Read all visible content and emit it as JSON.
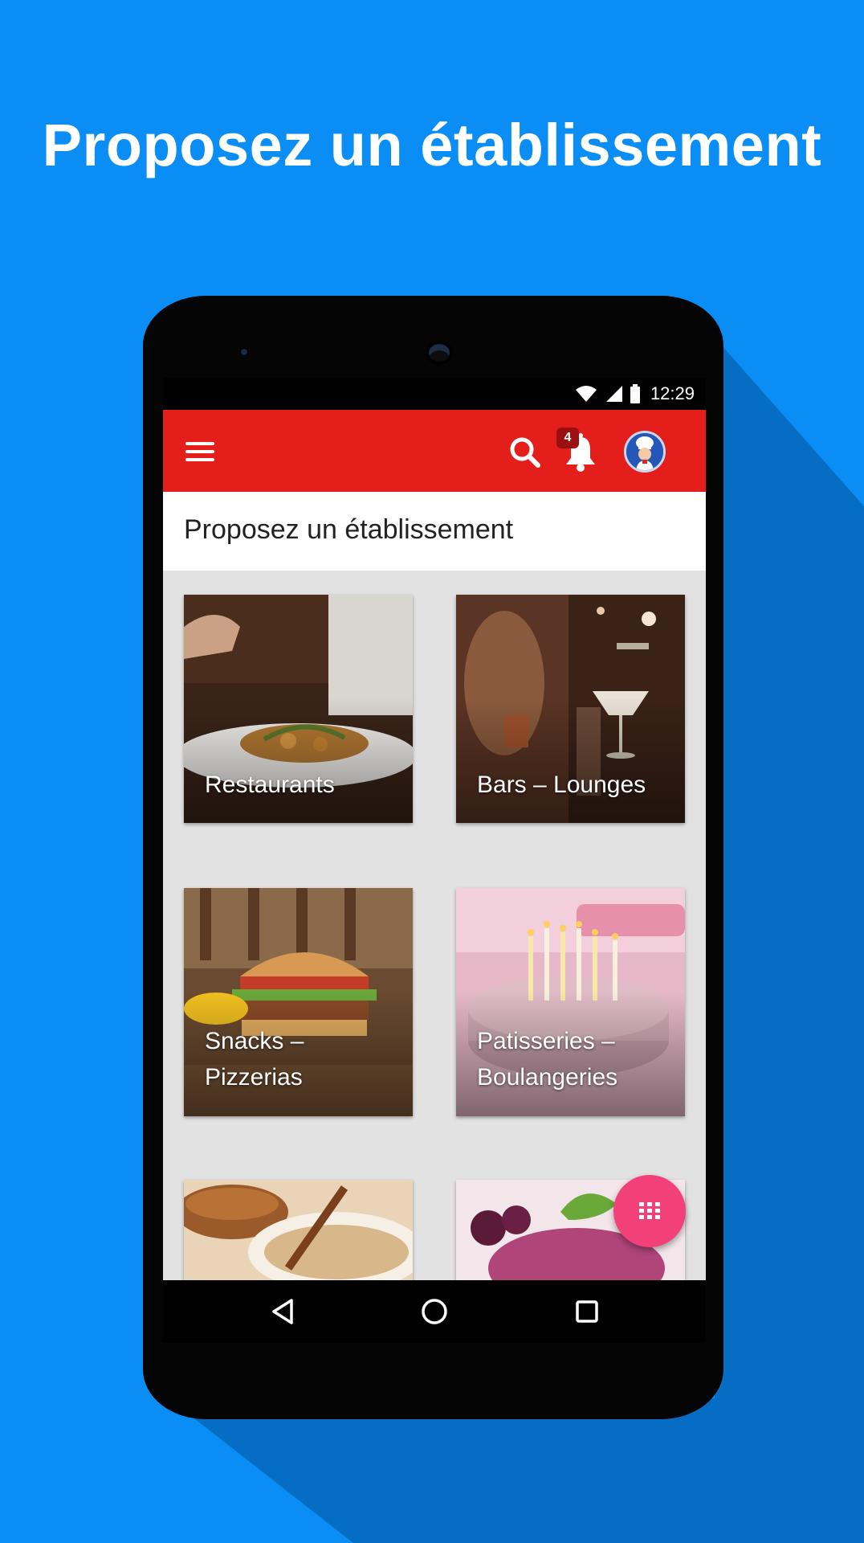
{
  "promo": {
    "title": "Proposez un établissement"
  },
  "status_bar": {
    "time": "12:29",
    "icons": [
      "wifi-icon",
      "signal-icon",
      "battery-icon"
    ]
  },
  "app_bar": {
    "color": "#e31e1b",
    "menu_icon": "menu-icon",
    "search_icon": "search-icon",
    "notifications": {
      "icon": "bell-icon",
      "count": "4"
    },
    "avatar_icon": "chef-avatar"
  },
  "page": {
    "title": "Proposez un établissement"
  },
  "categories": [
    {
      "label": "Restaurants"
    },
    {
      "label": "Bars – Lounges"
    },
    {
      "label": "Snacks – Pizzerias"
    },
    {
      "label": "Patisseries – Boulangeries"
    },
    {
      "label": ""
    },
    {
      "label": ""
    }
  ],
  "fab": {
    "icon": "grid-icon",
    "color": "#f2407a"
  },
  "nav_bar": {
    "icons": [
      "back-icon",
      "home-icon",
      "recents-icon"
    ]
  },
  "colors": {
    "background": "#0a8ef5",
    "accent": "#e31e1b"
  }
}
